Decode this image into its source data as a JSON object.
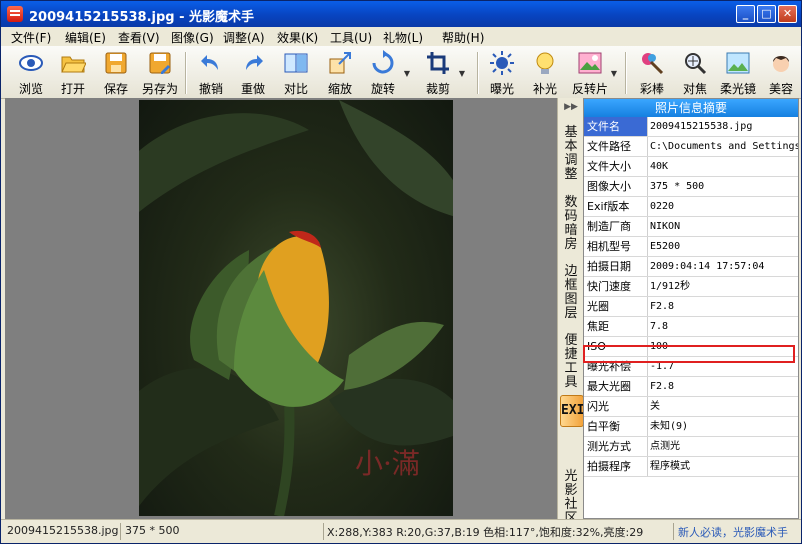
{
  "window": {
    "title": "2009415215538.jpg - 光影魔术手",
    "buttons": {
      "minimize": "_",
      "maximize": "□",
      "close": "✕"
    }
  },
  "menu": [
    {
      "label": "文件(F)"
    },
    {
      "label": "编辑(E)"
    },
    {
      "label": "查看(V)"
    },
    {
      "label": "图像(G)"
    },
    {
      "label": "调整(A)"
    },
    {
      "label": "效果(K)"
    },
    {
      "label": "工具(U)"
    },
    {
      "label": "礼物(L)"
    },
    {
      "label": "帮助(H)"
    }
  ],
  "toolbar": [
    {
      "label": "浏览",
      "icon": "eye-icon"
    },
    {
      "label": "打开",
      "icon": "folder-open-icon"
    },
    {
      "label": "保存",
      "icon": "save-icon"
    },
    {
      "label": "另存为",
      "icon": "save-as-icon"
    },
    {
      "label": "撤销",
      "icon": "undo-icon"
    },
    {
      "label": "重做",
      "icon": "redo-icon"
    },
    {
      "label": "对比",
      "icon": "compare-icon"
    },
    {
      "label": "缩放",
      "icon": "resize-icon"
    },
    {
      "label": "旋转",
      "icon": "rotate-icon"
    },
    {
      "label": "裁剪",
      "icon": "crop-icon"
    },
    {
      "label": "曝光",
      "icon": "exposure-icon"
    },
    {
      "label": "补光",
      "icon": "fill-light-icon"
    },
    {
      "label": "反转片",
      "icon": "reverse-film-icon"
    },
    {
      "label": "彩棒",
      "icon": "color-wand-icon"
    },
    {
      "label": "对焦",
      "icon": "focus-icon"
    },
    {
      "label": "柔光镜",
      "icon": "soft-light-icon"
    },
    {
      "label": "美容",
      "icon": "beauty-icon"
    }
  ],
  "image": {
    "watermark": "小·滿"
  },
  "side_tabs": {
    "items": [
      {
        "label": "基本调整"
      },
      {
        "label": "数码暗房"
      },
      {
        "label": "边框图层"
      },
      {
        "label": "便捷工具"
      },
      {
        "label": "EXIF",
        "active": true
      },
      {
        "label": "光影社区"
      }
    ]
  },
  "exif_panel": {
    "title": "照片信息摘要",
    "rows": [
      {
        "key": "文件名",
        "value": "2009415215538.jpg",
        "selected": true
      },
      {
        "key": "文件路径",
        "value": "C:\\Documents and Settings"
      },
      {
        "key": "文件大小",
        "value": "40K"
      },
      {
        "key": "图像大小",
        "value": "375 * 500"
      },
      {
        "key": "Exif版本",
        "value": "0220"
      },
      {
        "key": "制造厂商",
        "value": "NIKON"
      },
      {
        "key": "相机型号",
        "value": "E5200"
      },
      {
        "key": "拍摄日期",
        "value": "2009:04:14 17:57:04"
      },
      {
        "key": "快门速度",
        "value": "1/912秒"
      },
      {
        "key": "光圈",
        "value": "F2.8"
      },
      {
        "key": "焦距",
        "value": "7.8"
      },
      {
        "key": "ISO",
        "value": "100"
      },
      {
        "key": "曝光补偿",
        "value": "-1.7",
        "highlighted": true
      },
      {
        "key": "最大光圈",
        "value": "F2.8"
      },
      {
        "key": "闪光",
        "value": "关"
      },
      {
        "key": "白平衡",
        "value": "未知(9)"
      },
      {
        "key": "测光方式",
        "value": "点测光"
      },
      {
        "key": "拍摄程序",
        "value": "程序模式"
      }
    ]
  },
  "status": {
    "filename": "2009415215538.jpg",
    "dimensions": "375 * 500",
    "pixel_info": "X:288,Y:383 R:20,G:37,B:19 色相:117°,饱和度:32%,亮度:29",
    "link": "新人必读，光影魔术手"
  },
  "colors": {
    "title_bar": "#0a5ee8",
    "panel_header": "#1e90ff",
    "highlight_box": "#e02020",
    "active_tab": "#f2a23a"
  }
}
